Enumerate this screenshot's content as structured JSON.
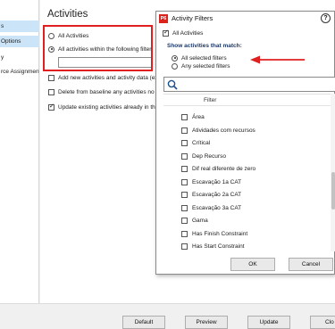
{
  "left_pane": {
    "items": [
      "s",
      "Options",
      "y",
      "rce Assignment"
    ]
  },
  "main": {
    "title": "Activities",
    "radio_all": "All Activities",
    "radio_within": "All activities within the following filter",
    "filter_value": "",
    "cb_add_new": "Add new activities and activity data (exce",
    "cb_delete": "Delete from baseline any activities no lon",
    "cb_update": "Update existing activities already in the b"
  },
  "dialog": {
    "title": "Activity Filters",
    "app_icon_label": "P6",
    "help_glyph": "?",
    "all_activities": "All Activities",
    "section_label": "Show activities that match:",
    "opt_all_selected": "All selected filters",
    "opt_any_selected": "Any selected filters",
    "search_placeholder": "",
    "column_header": "Filter",
    "filters": [
      "Área",
      "Atividades com recursos",
      "Crítical",
      "Dep Recurso",
      "Dif real diferente de zero",
      "Escavação 1a CAT",
      "Escavação 2a CAT",
      "Escavação 3a CAT",
      "Gama",
      "Has Finish Constraint",
      "Has Start Constraint"
    ],
    "ok_label": "OK",
    "cancel_label": "Cancel"
  },
  "bottom_bar": {
    "default_label": "Default",
    "preview_label": "Preview",
    "update_label": "Update",
    "close_label": "Clo"
  },
  "colors": {
    "highlight": "#e02020",
    "selection": "#cce4f7",
    "app_icon": "#d9231c"
  }
}
